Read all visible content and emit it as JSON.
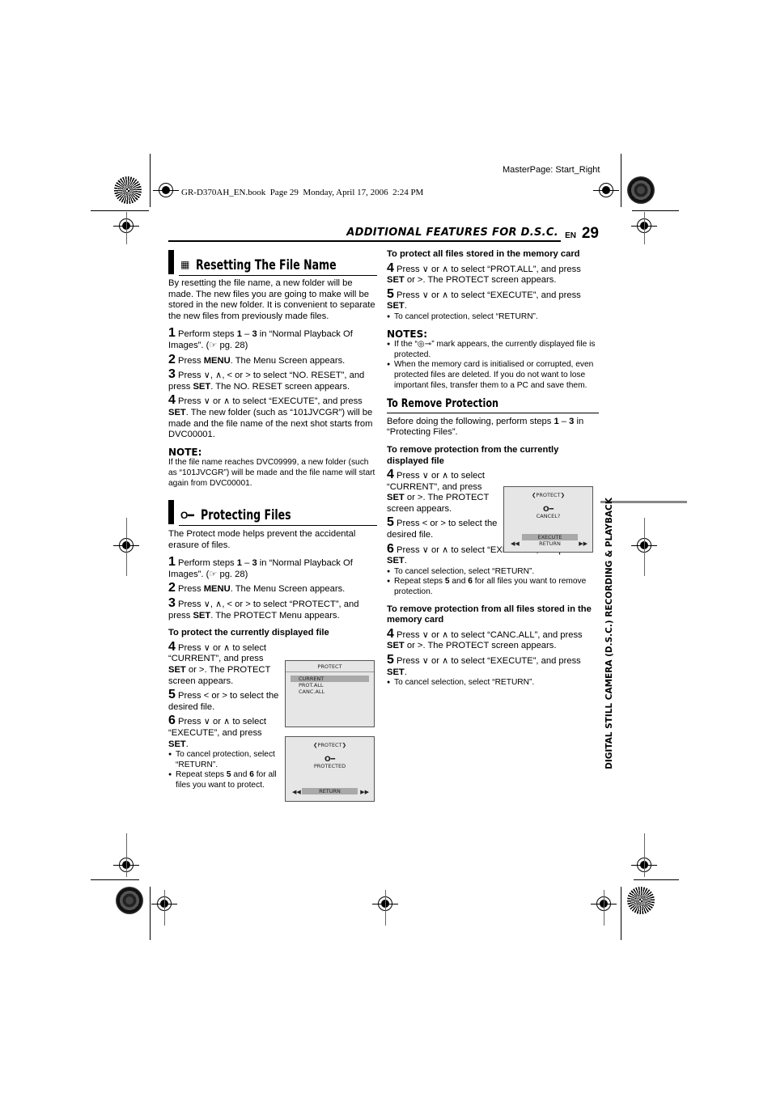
{
  "print_meta": {
    "masterpage": "MasterPage: Start_Right",
    "book_line": "GR-D370AH_EN.book  Page 29  Monday, April 17, 2006  2:24 PM"
  },
  "header": {
    "section_title": "ADDITIONAL FEATURES FOR D.S.C.",
    "lang": "EN",
    "page_number": "29"
  },
  "side_tab": "DIGITAL STILL CAMERA (D.S.C.) RECORDING & PLAYBACK",
  "reset": {
    "title": "Resetting The File Name",
    "icon": "reset-file-icon",
    "intro": "By resetting the file name, a new folder will be made. The new files you are going to make will be stored in the new folder. It is convenient to separate the new files from previously made files.",
    "steps": [
      {
        "n": "1",
        "pre": "Perform steps ",
        "b1": "1",
        "mid": " – ",
        "b2": "3",
        "post": " in “Normal Playback Of Images”. (☞ pg. 28)"
      },
      {
        "n": "2",
        "pre": "Press ",
        "b1": "MENU",
        "post": ". The Menu Screen appears."
      },
      {
        "n": "3",
        "pre": "Press ∨, ∧, < or > to select “NO. RESET”, and press ",
        "b1": "SET",
        "post": ". The NO. RESET screen appears."
      },
      {
        "n": "4",
        "pre": "Press ∨ or ∧ to select “EXECUTE”, and press ",
        "b1": "SET",
        "post": ". The new folder (such as “101JVCGR”) will be made and the file name of the next shot starts from DVC00001."
      }
    ],
    "note_heading": "NOTE:",
    "note": "If the file name reaches DVC09999, a new folder (such as “101JVCGR”) will be made and the file name will start again from DVC00001."
  },
  "protect": {
    "title": "Protecting Files",
    "icon": "key-icon",
    "intro": "The Protect mode helps prevent the accidental erasure of files.",
    "steps": [
      {
        "n": "1",
        "pre": "Perform steps ",
        "b1": "1",
        "mid": " – ",
        "b2": "3",
        "post": " in “Normal Playback Of Images”. (☞ pg. 28)"
      },
      {
        "n": "2",
        "pre": "Press ",
        "b1": "MENU",
        "post": ". The Menu Screen appears."
      },
      {
        "n": "3",
        "pre": "Press ∨, ∧, < or > to select “PROTECT”, and press ",
        "b1": "SET",
        "post": ". The PROTECT Menu appears."
      }
    ],
    "current": {
      "heading": "To protect the currently displayed file",
      "s4": {
        "n": "4",
        "pre": "Press ∨ or ∧ to select “CURRENT”, and press ",
        "b1": "SET",
        "post": " or >. The PROTECT screen appears."
      },
      "s5": {
        "n": "5",
        "text": "Press < or > to select the desired file."
      },
      "s6": {
        "n": "6",
        "pre": "Press ∨ or ∧ to select “EXECUTE”, and press ",
        "b1": "SET",
        "post": "."
      },
      "bullets": [
        "To cancel protection, select “RETURN”."
      ],
      "bullet2": {
        "pre": "Repeat steps ",
        "b1": "5",
        "mid": " and ",
        "b2": "6",
        "post": " for all files you want to protect."
      }
    },
    "all": {
      "heading": "To protect all files stored in the memory card",
      "s4": {
        "n": "4",
        "pre": "Press ∨ or ∧ to select “PROT.ALL”, and press ",
        "b1": "SET",
        "post": " or >. The PROTECT screen appears."
      },
      "s5": {
        "n": "5",
        "pre": "Press ∨ or ∧ to select “EXECUTE”, and press ",
        "b1": "SET",
        "post": "."
      },
      "bullet": "To cancel protection, select “RETURN”."
    },
    "notes_heading": "NOTES:",
    "notes": [
      "If the “◎⊸” mark appears, the currently displayed file is protected.",
      "When the memory card is initialised or corrupted, even protected files are deleted. If you do not want to lose important files, transfer them to a PC and save them."
    ]
  },
  "remove": {
    "title": "To Remove Protection",
    "intro_pre": "Before doing the following, perform steps ",
    "intro_b1": "1",
    "intro_mid": " – ",
    "intro_b2": "3",
    "intro_post": " in “Protecting Files”.",
    "current": {
      "heading": "To remove protection from the currently displayed file",
      "s4": {
        "n": "4",
        "pre": "Press ∨ or ∧ to select “CURRENT”, and press ",
        "b1": "SET",
        "post": " or >. The PROTECT screen appears."
      },
      "s5": {
        "n": "5",
        "text": "Press < or > to select the desired file."
      },
      "s6": {
        "n": "6",
        "pre": "Press ∨ or ∧ to select “EXECUTE”, and press ",
        "b1": "SET",
        "post": "."
      },
      "bullet1": "To cancel selection, select “RETURN”.",
      "bullet2": {
        "pre": "Repeat steps ",
        "b1": "5",
        "mid": " and ",
        "b2": "6",
        "post": " for all files you want to remove protection."
      }
    },
    "all": {
      "heading": "To remove protection from all files stored in the memory card",
      "s4": {
        "n": "4",
        "pre": "Press ∨ or ∧ to select “CANC.ALL”, and press ",
        "b1": "SET",
        "post": " or >. The PROTECT screen appears."
      },
      "s5": {
        "n": "5",
        "pre": "Press ∨ or ∧ to select “EXECUTE”, and press ",
        "b1": "SET",
        "post": "."
      },
      "bullet": "To cancel selection, select “RETURN”."
    }
  },
  "screens": {
    "menu": {
      "title": "PROTECT",
      "items": [
        "CURRENT",
        "PROT.ALL",
        "CANC.ALL"
      ],
      "selected": "CURRENT"
    },
    "protected": {
      "title": "❮PROTECT❯",
      "status": "PROTECTED",
      "option": "RETURN",
      "prev": "◀◀",
      "next": "▶▶"
    },
    "cancel": {
      "title": "❮PROTECT❯",
      "status": "CANCEL?",
      "options": [
        "EXECUTE",
        "RETURN"
      ],
      "prev": "◀◀",
      "next": "▶▶"
    }
  }
}
